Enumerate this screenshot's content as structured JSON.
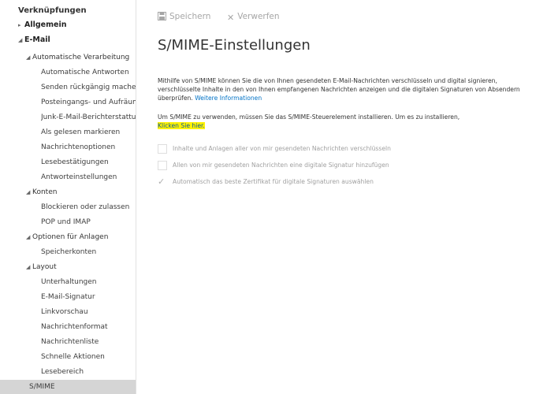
{
  "sidebar": {
    "header": "Verknüpfungen",
    "items": [
      {
        "label": "Allgemein",
        "caret": "▸"
      },
      {
        "label": "E-Mail",
        "caret": "◢"
      },
      {
        "label": "Automatische Verarbeitung",
        "caret": "◢"
      },
      {
        "label": "Automatische Antworten"
      },
      {
        "label": "Senden rückgängig machen"
      },
      {
        "label": "Posteingangs- und Aufräumregeln"
      },
      {
        "label": "Junk-E-Mail-Berichterstattung"
      },
      {
        "label": "Als gelesen markieren"
      },
      {
        "label": "Nachrichtenoptionen"
      },
      {
        "label": "Lesebestätigungen"
      },
      {
        "label": "Antworteinstellungen"
      },
      {
        "label": "Konten",
        "caret": "◢"
      },
      {
        "label": "Blockieren oder zulassen"
      },
      {
        "label": "POP und IMAP"
      },
      {
        "label": "Optionen für Anlagen",
        "caret": "◢"
      },
      {
        "label": "Speicherkonten"
      },
      {
        "label": "Layout",
        "caret": "◢"
      },
      {
        "label": "Unterhaltungen"
      },
      {
        "label": "E-Mail-Signatur"
      },
      {
        "label": "Linkvorschau"
      },
      {
        "label": "Nachrichtenformat"
      },
      {
        "label": "Nachrichtenliste"
      },
      {
        "label": "Schnelle Aktionen"
      },
      {
        "label": "Lesebereich"
      },
      {
        "label": "S/MIME"
      }
    ]
  },
  "toolbar": {
    "save_label": "Speichern",
    "discard_label": "Verwerfen"
  },
  "main": {
    "title": "S/MIME-Einstellungen",
    "intro_text": "Mithilfe von S/MIME können Sie die von Ihnen gesendeten E-Mail-Nachrichten verschlüsseln und digital signieren, verschlüsselte Inhalte in den von Ihnen empfangenen Nachrichten anzeigen und die digitalen Signaturen von Absendern überprüfen.",
    "more_info_link": "Weitere Informationen",
    "install_text": "Um S/MIME zu verwenden, müssen Sie das S/MIME-Steuerelement installieren. Um es zu installieren,",
    "install_link": "Klicken Sie hier.",
    "options": [
      {
        "label": "Inhalte und Anlagen aller von mir gesendeten Nachrichten verschlüsseln",
        "checked": false
      },
      {
        "label": "Allen von mir gesendeten Nachrichten eine digitale Signatur hinzufügen",
        "checked": false
      },
      {
        "label": "Automatisch das beste Zertifikat für digitale Signaturen auswählen",
        "checked": true
      }
    ]
  },
  "colors": {
    "link": "#0072c6",
    "highlight": "#fff200",
    "selected_bg": "#d5d5d5",
    "disabled_text": "#a0a0a0"
  }
}
